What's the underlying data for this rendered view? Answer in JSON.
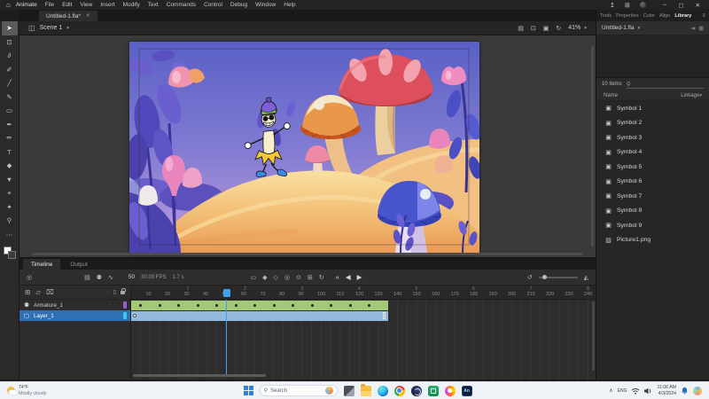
{
  "titlebar": {
    "app_name": "Animate",
    "menus": [
      "File",
      "Edit",
      "View",
      "Insert",
      "Modify",
      "Text",
      "Commands",
      "Control",
      "Debug",
      "Window",
      "Help"
    ]
  },
  "document_tab": {
    "title": "Untitled-1.fla*"
  },
  "scene_bar": {
    "scene_name": "Scene 1",
    "zoom_level": "41%"
  },
  "tools": [
    {
      "name": "selection",
      "glyph": "➤",
      "selected": true
    },
    {
      "name": "free-transform",
      "glyph": "⊡"
    },
    {
      "name": "lasso",
      "glyph": "∂"
    },
    {
      "name": "fluid-brush",
      "glyph": "✐"
    },
    {
      "name": "line",
      "glyph": "╱"
    },
    {
      "name": "classic-brush",
      "glyph": "✎"
    },
    {
      "name": "rectangle",
      "glyph": "▭"
    },
    {
      "name": "pen",
      "glyph": "✒"
    },
    {
      "name": "pencil",
      "glyph": "✏"
    },
    {
      "name": "text",
      "glyph": "T"
    },
    {
      "name": "paint-bucket",
      "glyph": "◆"
    },
    {
      "name": "eyedropper",
      "glyph": "▼"
    },
    {
      "name": "bone",
      "glyph": "⌖"
    },
    {
      "name": "asset-warp",
      "glyph": "✦"
    },
    {
      "name": "zoom",
      "glyph": "⚲"
    },
    {
      "name": "more-tools",
      "glyph": "⋯"
    }
  ],
  "right_panel": {
    "tabs": [
      "Tools",
      "Properties",
      "Color",
      "Align",
      "Library"
    ],
    "active_tab": "Library",
    "library": {
      "document": "Untitled-1.fla",
      "count": "10 items",
      "columns": [
        "Name",
        "Linkage"
      ],
      "items": [
        {
          "name": "Symbol 1",
          "type": "symbol"
        },
        {
          "name": "Symbol 2",
          "type": "symbol"
        },
        {
          "name": "Symbol 3",
          "type": "symbol"
        },
        {
          "name": "Symbol 4",
          "type": "symbol"
        },
        {
          "name": "Symbol 5",
          "type": "symbol"
        },
        {
          "name": "Symbol 6",
          "type": "symbol"
        },
        {
          "name": "Symbol 7",
          "type": "symbol"
        },
        {
          "name": "Symbol 8",
          "type": "symbol"
        },
        {
          "name": "Symbol 9",
          "type": "symbol"
        },
        {
          "name": "Picture1.png",
          "type": "bitmap"
        }
      ]
    }
  },
  "timeline": {
    "tabs": [
      "Timeline",
      "Output"
    ],
    "active_tab": "Timeline",
    "toolbar": {
      "frame": "50",
      "fps": "30.00 FPS",
      "time": "1.7 s"
    },
    "ruler": {
      "start": 10,
      "end": 240,
      "step": 10,
      "seconds_every": 30,
      "seconds_max": 8
    },
    "playhead_frame": 50,
    "layers": [
      {
        "name": "Armature_1",
        "type": "armature",
        "outline_color": "#9b59d0",
        "span_frames": 135,
        "keyframes_from": 5,
        "keyframes_every": 10,
        "keyframes_to": 125,
        "selected": false
      },
      {
        "name": "Layer_1",
        "type": "normal",
        "outline_color": "#35c8f5",
        "span_frames": 135,
        "selected": true
      }
    ],
    "colors": {
      "armature_green": "#a3c878",
      "selection_blue": "#93b9dc",
      "playhead_blue": "#3da0f0"
    }
  },
  "taskbar": {
    "weather": {
      "temp": "74°F",
      "condition": "Mostly cloudy"
    },
    "search_label": "Search",
    "animate_label": "An",
    "icons": [
      "start",
      "search",
      "task-view",
      "file-explorer",
      "edge",
      "chrome",
      "copilot",
      "green-app",
      "swirl-app",
      "animate"
    ],
    "tray": {
      "language": "ENG",
      "time": "11:06 AM",
      "date": "4/3/2024"
    }
  },
  "stage": {
    "palette": {
      "sky_top": "#5a60c6",
      "sky_bottom": "#c09fd4",
      "sand_light": "#f8e0a0",
      "sand_deep": "#e99a55",
      "plant_purple": "#5348bb",
      "flower_pink": "#ea84bc",
      "mushroom_red": "#dd4f5c",
      "mushroom_orange": "#e8974b",
      "mushroom_blue": "#4754cc",
      "banana_yellow": "#f5c832"
    }
  },
  "icons": {
    "home": "⌂",
    "share": "↥",
    "workspace": "⊞",
    "minimize": "─",
    "maximize": "▢",
    "close": "✕",
    "menu": "≡",
    "chevron_down": "▾",
    "chevron_up": "∧",
    "scene": "◫",
    "camera": "▤",
    "center_stage": "⊡",
    "clip_content": "▣",
    "rotation": "↻",
    "search": "⚲",
    "pin": "⇥",
    "new_library": "⊞",
    "symbol_item": "▣",
    "bitmap_item": "▨",
    "options": "◎",
    "parent_view": "⚉",
    "graph": "∿",
    "insert_frame": "▭",
    "insert_keyframe": "◆",
    "blank_keyframe": "◇",
    "onion": "◎",
    "onion_outline": "⊙",
    "multi_frame": "⊞",
    "loop": "↻",
    "first": "«",
    "prev": "◀",
    "play": "▶",
    "reset_zoom": "↺",
    "mountains": "◭",
    "add_layer": "⊞",
    "add_folder": "▱",
    "delete_layer": "⌧",
    "outline_col": "▯",
    "dot": "·",
    "armature_layer": "⚉",
    "normal_layer": "▢"
  }
}
